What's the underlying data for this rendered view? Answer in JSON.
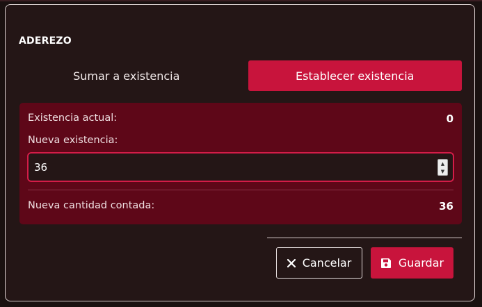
{
  "modal": {
    "title": "ADEREZO"
  },
  "tabs": [
    {
      "label": "Sumar a existencia",
      "active": false
    },
    {
      "label": "Establecer existencia",
      "active": true
    }
  ],
  "stock": {
    "current_label": "Existencia actual:",
    "current_value": "0",
    "new_label": "Nueva existencia:",
    "new_input_value": "36",
    "counted_label": "Nueva cantidad contada:",
    "counted_value": "36"
  },
  "actions": {
    "cancel_label": "Cancelar",
    "cancel_icon": "close-icon",
    "save_label": "Guardar",
    "save_icon": "floppy-disk-icon"
  },
  "colors": {
    "accent": "#c8143c",
    "panel": "#5e0718",
    "background": "#241616"
  }
}
